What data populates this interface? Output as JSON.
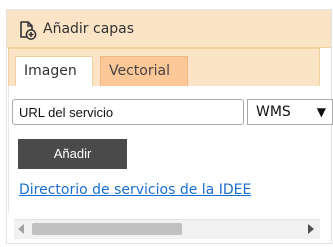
{
  "header": {
    "title": "Añadir capas",
    "icon": "add-layer-icon"
  },
  "tabs": [
    {
      "label": "Imagen",
      "active": true
    },
    {
      "label": "Vectorial",
      "active": false
    }
  ],
  "form": {
    "url_value": "URL del servicio",
    "service_type_selected": "WMS",
    "add_button_label": "Añadir"
  },
  "link": {
    "label": "Directorio de servicios de la IDEE"
  },
  "colors": {
    "header_bg": "#fbe4c6",
    "active_tab_bg": "#ffffff",
    "inactive_tab_bg": "#fcc898",
    "button_bg": "#4a4a4a",
    "link": "#1a6dd1"
  }
}
